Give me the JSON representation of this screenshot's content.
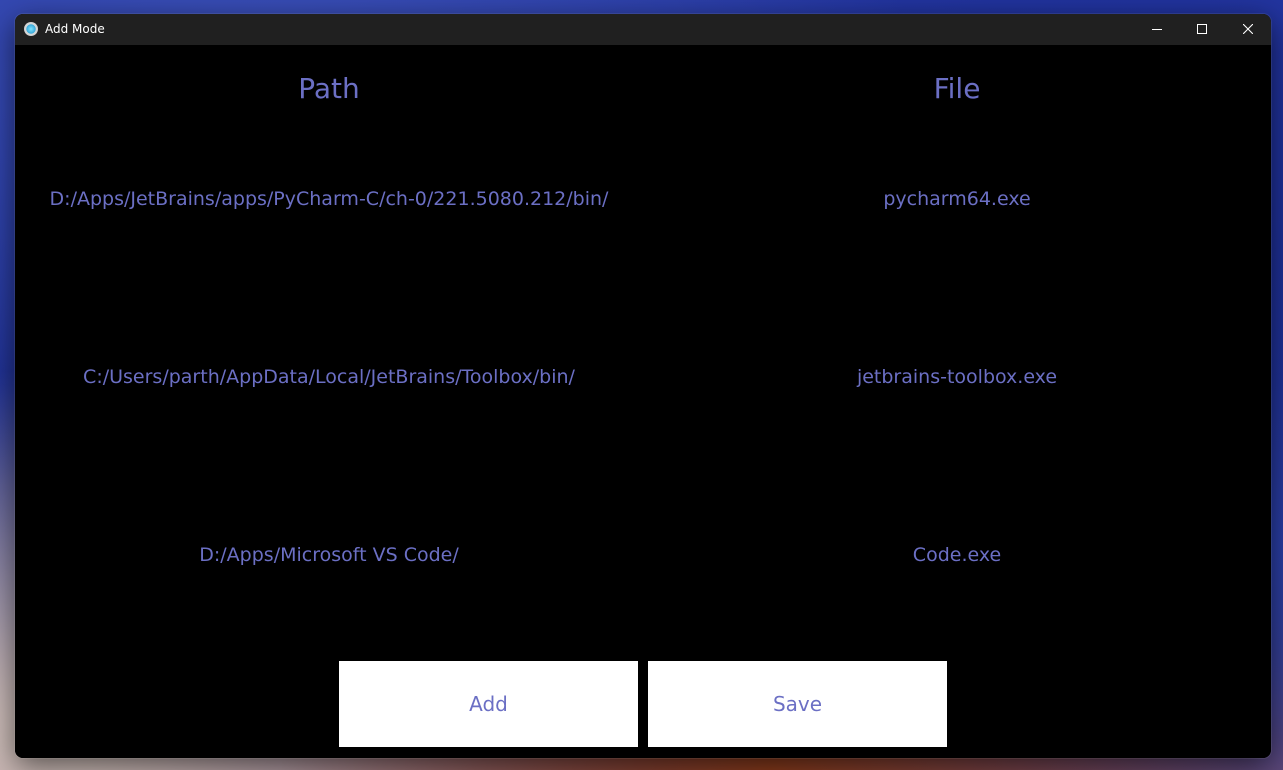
{
  "window": {
    "title": "Add Mode",
    "icons": {
      "app": "app-icon",
      "minimize": "minimize-icon",
      "maximize": "maximize-icon",
      "close": "close-icon"
    }
  },
  "table": {
    "headers": {
      "path": "Path",
      "file": "File"
    },
    "rows": [
      {
        "path": "D:/Apps/JetBrains/apps/PyCharm-C/ch-0/221.5080.212/bin/",
        "file": "pycharm64.exe"
      },
      {
        "path": "C:/Users/parth/AppData/Local/JetBrains/Toolbox/bin/",
        "file": "jetbrains-toolbox.exe"
      },
      {
        "path": "D:/Apps/Microsoft VS Code/",
        "file": "Code.exe"
      }
    ]
  },
  "actions": {
    "add_label": "Add",
    "save_label": "Save"
  },
  "colors": {
    "text_accent": "#6b6fc4",
    "window_bg": "#000000",
    "titlebar_bg": "#202020",
    "button_bg": "#ffffff"
  }
}
